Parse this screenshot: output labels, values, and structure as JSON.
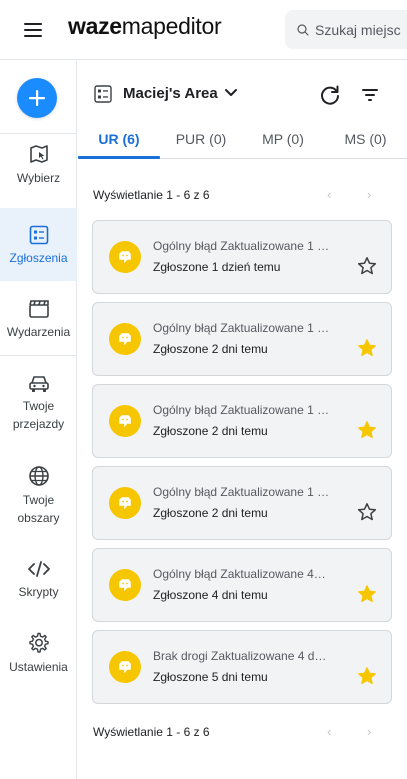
{
  "header": {
    "logo_bold": "waze",
    "logo_light": "mapeditor",
    "search_placeholder": "Szukaj miejsc"
  },
  "rail": {
    "items": [
      {
        "label": "Wybierz",
        "icon": "select-map-icon"
      },
      {
        "label": "Zgłoszenia",
        "icon": "reports-icon",
        "active": true
      },
      {
        "label": "Wydarzenia",
        "icon": "events-clapperboard-icon"
      },
      {
        "label": "Twoje przejazdy",
        "icon": "car-icon"
      },
      {
        "label": "Twoje obszary",
        "icon": "globe-icon"
      },
      {
        "label": "Skrypty",
        "icon": "code-icon"
      },
      {
        "label": "Ustawienia",
        "icon": "gear-icon"
      }
    ]
  },
  "panel": {
    "area_name": "Maciej's Area",
    "tabs": [
      {
        "label": "UR (6)",
        "active": true
      },
      {
        "label": "PUR (0)"
      },
      {
        "label": "MP (0)"
      },
      {
        "label": "MS (0)"
      }
    ],
    "showing_top": "Wyświetlanie 1 - 6 z 6",
    "showing_bottom": "Wyświetlanie 1 - 6 z 6",
    "pager_prev": "‹",
    "pager_next": "›"
  },
  "reports": [
    {
      "title": "Ogólny błąd Zaktualizowane 1 …",
      "subtitle": "Zgłoszone 1 dzień temu",
      "starred": false
    },
    {
      "title": "Ogólny błąd Zaktualizowane 1 …",
      "subtitle": "Zgłoszone 2 dni temu",
      "starred": true
    },
    {
      "title": "Ogólny błąd Zaktualizowane 1 …",
      "subtitle": "Zgłoszone 2 dni temu",
      "starred": true
    },
    {
      "title": "Ogólny błąd Zaktualizowane 1 …",
      "subtitle": "Zgłoszone 2 dni temu",
      "starred": false
    },
    {
      "title": "Ogólny błąd Zaktualizowane 4…",
      "subtitle": "Zgłoszone 4 dni temu",
      "starred": true
    },
    {
      "title": "Brak drogi Zaktualizowane 4 d…",
      "subtitle": "Zgłoszone 5 dni temu",
      "starred": true
    }
  ],
  "colors": {
    "accent": "#1a6fd8",
    "fab": "#1a8cff",
    "badge": "#f6c600",
    "star_filled": "#f6c600"
  }
}
